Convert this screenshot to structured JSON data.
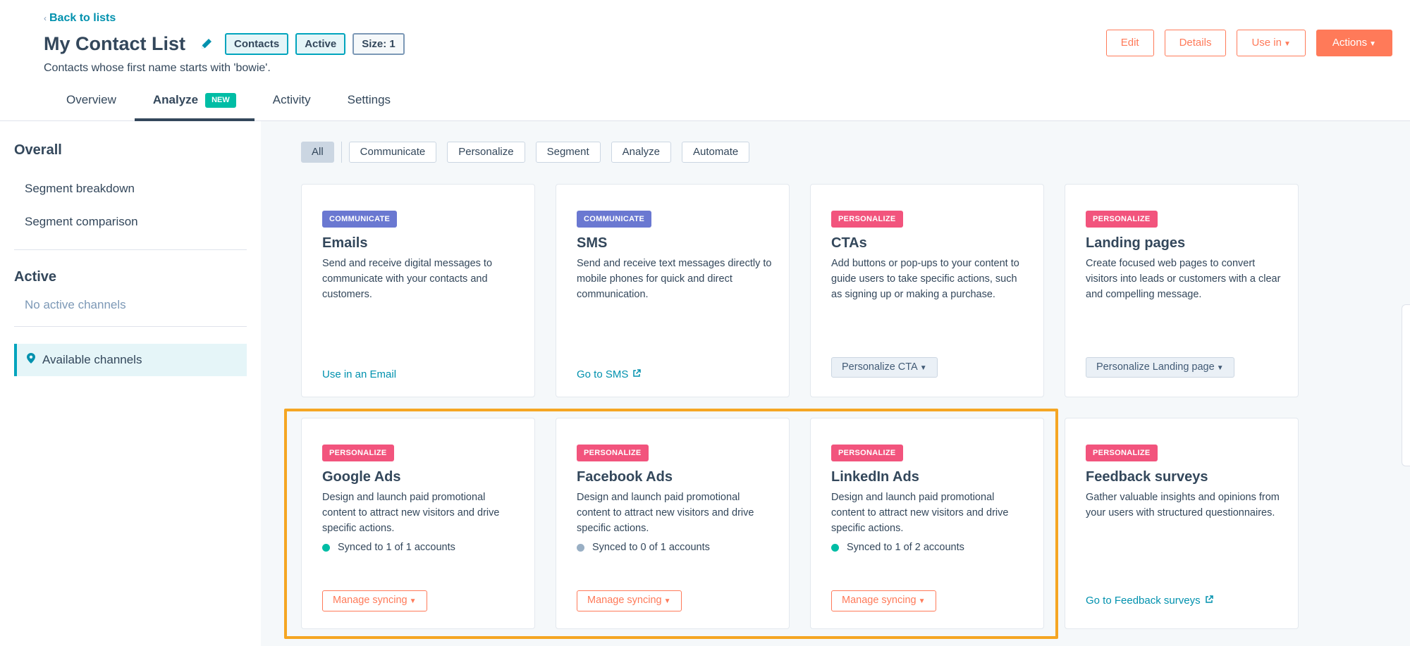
{
  "header": {
    "back_label": "Back to lists",
    "title": "My Contact List",
    "tags": [
      "Contacts",
      "Active",
      "Size: 1"
    ],
    "subtitle": "Contacts whose first name starts with 'bowie'.",
    "buttons": {
      "edit": "Edit",
      "details": "Details",
      "use_in": "Use in",
      "actions": "Actions"
    }
  },
  "tabs": [
    {
      "label": "Overview"
    },
    {
      "label": "Analyze",
      "badge": "NEW"
    },
    {
      "label": "Activity"
    },
    {
      "label": "Settings"
    }
  ],
  "sidebar": {
    "overall_heading": "Overall",
    "overall_items": [
      "Segment breakdown",
      "Segment comparison"
    ],
    "active_heading": "Active",
    "active_empty": "No active channels",
    "selected_item": "Available channels"
  },
  "filters": [
    "All",
    "Communicate",
    "Personalize",
    "Segment",
    "Analyze",
    "Automate"
  ],
  "cards": [
    {
      "category": "COMMUNICATE",
      "title": "Emails",
      "description": "Send and receive digital messages to communicate with your contacts and customers.",
      "action": "Use in an Email"
    },
    {
      "category": "COMMUNICATE",
      "title": "SMS",
      "description": "Send and receive text messages directly to mobile phones for quick and direct communication.",
      "action": "Go to SMS"
    },
    {
      "category": "PERSONALIZE",
      "title": "CTAs",
      "description": "Add buttons or pop-ups to your content to guide users to take specific actions, such as signing up or making a purchase.",
      "action": "Personalize CTA"
    },
    {
      "category": "PERSONALIZE",
      "title": "Landing pages",
      "description": "Create focused web pages to convert visitors into leads or customers with a clear and compelling message.",
      "action": "Personalize Landing page"
    },
    {
      "category": "PERSONALIZE",
      "title": "Google Ads",
      "description": "Design and launch paid promotional content to attract new visitors and drive specific actions.",
      "sync_status": "Synced to 1 of 1 accounts",
      "action": "Manage syncing"
    },
    {
      "category": "PERSONALIZE",
      "title": "Facebook Ads",
      "description": "Design and launch paid promotional content to attract new visitors and drive specific actions.",
      "sync_status": "Synced to 0 of 1 accounts",
      "action": "Manage syncing"
    },
    {
      "category": "PERSONALIZE",
      "title": "LinkedIn Ads",
      "description": "Design and launch paid promotional content to attract new visitors and drive specific actions.",
      "sync_status": "Synced to 1 of 2 accounts",
      "action": "Manage syncing"
    },
    {
      "category": "PERSONALIZE",
      "title": "Feedback surveys",
      "description": "Gather valuable insights and opinions from your users with structured questionnaires.",
      "action": "Go to Feedback surveys"
    }
  ],
  "colors": {
    "accent": "#ff7a59",
    "link": "#0091ae",
    "communicate": "#6a78d1",
    "personalize": "#f2547d",
    "synced": "#00bda5",
    "not_synced": "#99afc4",
    "highlight": "#f5a623"
  }
}
